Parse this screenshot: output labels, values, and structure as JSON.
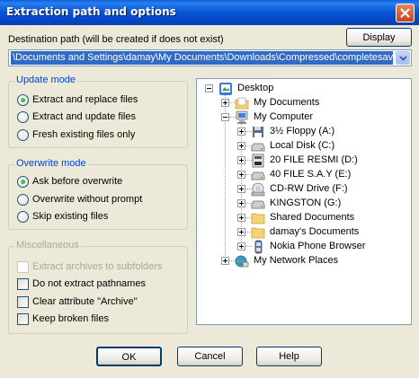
{
  "window": {
    "title": "Extraction path and options"
  },
  "destination": {
    "label": "Destination path (will be created if does not exist)",
    "display_button": "Display",
    "path_value": "\\Documents and Settings\\damay\\My Documents\\Downloads\\Compressed\\completesave"
  },
  "update_mode": {
    "title": "Update mode",
    "options": [
      "Extract and replace files",
      "Extract and update files",
      "Fresh existing files only"
    ],
    "selected": 0
  },
  "overwrite_mode": {
    "title": "Overwrite mode",
    "options": [
      "Ask before overwrite",
      "Overwrite without prompt",
      "Skip existing files"
    ],
    "selected": 0
  },
  "misc": {
    "title": "Miscellaneous",
    "options": [
      {
        "label": "Extract archives to subfolders",
        "checked": false,
        "enabled": false
      },
      {
        "label": "Do not extract pathnames",
        "checked": false,
        "enabled": true
      },
      {
        "label": "Clear attribute \"Archive\"",
        "checked": false,
        "enabled": true
      },
      {
        "label": "Keep broken files",
        "checked": false,
        "enabled": true
      }
    ]
  },
  "tree": {
    "desktop": "Desktop",
    "my_documents": "My Documents",
    "my_computer": "My Computer",
    "drives": [
      {
        "label": "3½ Floppy (A:)",
        "icon": "floppy-icon"
      },
      {
        "label": "Local Disk (C:)",
        "icon": "drive-icon"
      },
      {
        "label": "20  FILE RESMI (D:)",
        "icon": "drive-icon"
      },
      {
        "label": "40 FILE S.A.Y (E:)",
        "icon": "drive-icon"
      },
      {
        "label": "CD-RW Drive (F:)",
        "icon": "cd-drive-icon"
      },
      {
        "label": "KINGSTON (G:)",
        "icon": "drive-icon"
      },
      {
        "label": "Shared Documents",
        "icon": "folder-icon"
      },
      {
        "label": "damay's Documents",
        "icon": "folder-icon"
      },
      {
        "label": "Nokia Phone Browser",
        "icon": "phone-icon"
      }
    ],
    "network": "My Network Places"
  },
  "buttons": {
    "ok": "OK",
    "cancel": "Cancel",
    "help": "Help"
  },
  "colors": {
    "title_bar": "#0a58d6",
    "selection": "#316ac5",
    "group_title": "#0046d5",
    "face": "#ece9d8"
  }
}
